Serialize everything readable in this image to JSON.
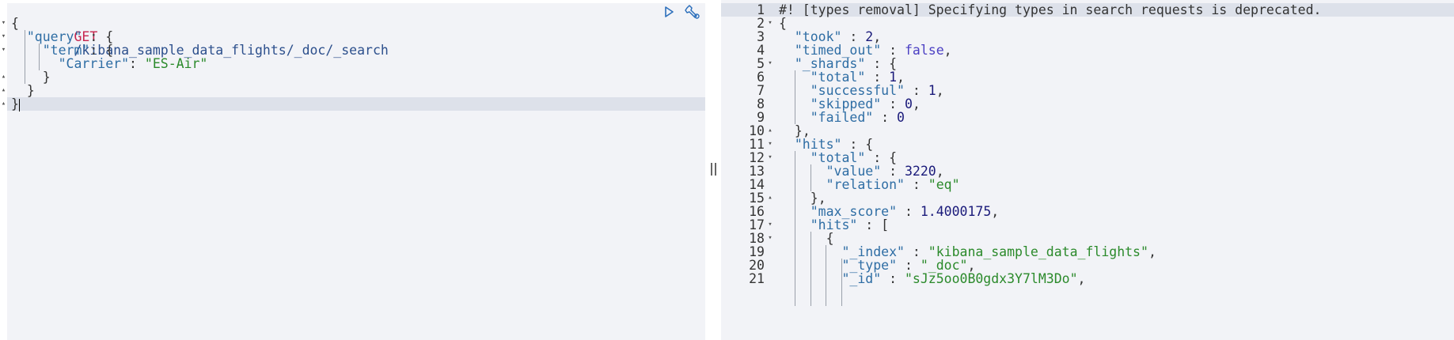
{
  "request": {
    "method": "GET",
    "path": "/kibana_sample_data_flights/_doc/_search",
    "lines": [
      "{",
      "  \"query\" : {",
      "    \"term\": {",
      "      \"Carrier\": \"ES-Air\"",
      "    }",
      "  }",
      "}"
    ],
    "toolbar": {
      "run_icon": "play-icon",
      "settings_icon": "wrench-icon"
    }
  },
  "response": {
    "numbers": [
      "1",
      "2",
      "3",
      "4",
      "5",
      "6",
      "7",
      "8",
      "9",
      "10",
      "11",
      "12",
      "13",
      "14",
      "15",
      "16",
      "17",
      "18",
      "19",
      "20",
      "21"
    ],
    "comment": "#! [types removal] Specifying types in search requests is deprecated.",
    "lines": [
      "#! [types removal] Specifying types in search requests is deprecated.",
      "{",
      "  \"took\" : 2,",
      "  \"timed_out\" : false,",
      "  \"_shards\" : {",
      "    \"total\" : 1,",
      "    \"successful\" : 1,",
      "    \"skipped\" : 0,",
      "    \"failed\" : 0",
      "  },",
      "  \"hits\" : {",
      "    \"total\" : {",
      "      \"value\" : 3220,",
      "      \"relation\" : \"eq\"",
      "    },",
      "    \"max_score\" : 1.4000175,",
      "    \"hits\" : [",
      "      {",
      "        \"_index\" : \"kibana_sample_data_flights\",",
      "        \"_type\" : \"_doc\",",
      "        \"_id\" : \"sJz5oo0B0gdx3Y7lM3Do\","
    ]
  },
  "colors": {
    "method": "#c7254e",
    "key": "#2e6da4",
    "string": "#2b8a2b",
    "number": "#1a1a7a",
    "boolean": "#4b3fc3",
    "error": "#d9322f"
  }
}
